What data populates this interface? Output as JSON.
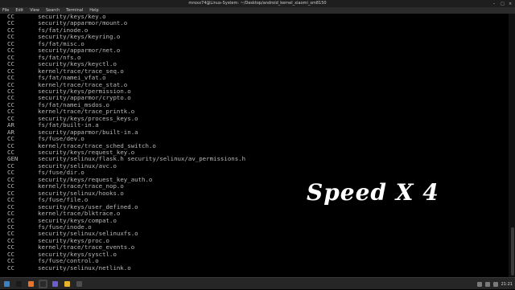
{
  "window": {
    "title": "mroxx74@Linux-System: ~/Desktop/android_kernel_xiaomi_sm8150"
  },
  "menubar": {
    "items": [
      "File",
      "Edit",
      "View",
      "Search",
      "Terminal",
      "Help"
    ]
  },
  "terminal": {
    "lines": [
      {
        "cmd": "CC",
        "path": "security/keys/key.o"
      },
      {
        "cmd": "CC",
        "path": "security/apparmor/mount.o"
      },
      {
        "cmd": "CC",
        "path": "fs/fat/inode.o"
      },
      {
        "cmd": "CC",
        "path": "security/keys/keyring.o"
      },
      {
        "cmd": "CC",
        "path": "fs/fat/misc.o"
      },
      {
        "cmd": "CC",
        "path": "security/apparmor/net.o"
      },
      {
        "cmd": "CC",
        "path": "fs/fat/nfs.o"
      },
      {
        "cmd": "CC",
        "path": "security/keys/keyctl.o"
      },
      {
        "cmd": "CC",
        "path": "kernel/trace/trace_seq.o"
      },
      {
        "cmd": "CC",
        "path": "fs/fat/namei_vfat.o"
      },
      {
        "cmd": "CC",
        "path": "kernel/trace/trace_stat.o"
      },
      {
        "cmd": "CC",
        "path": "security/keys/permission.o"
      },
      {
        "cmd": "CC",
        "path": "security/apparmor/crypto.o"
      },
      {
        "cmd": "CC",
        "path": "fs/fat/namei_msdos.o"
      },
      {
        "cmd": "CC",
        "path": "kernel/trace/trace_printk.o"
      },
      {
        "cmd": "CC",
        "path": "security/keys/process_keys.o"
      },
      {
        "cmd": "AR",
        "path": "fs/fat/built-in.a"
      },
      {
        "cmd": "AR",
        "path": "security/apparmor/built-in.a"
      },
      {
        "cmd": "CC",
        "path": "fs/fuse/dev.o"
      },
      {
        "cmd": "CC",
        "path": "kernel/trace/trace_sched_switch.o"
      },
      {
        "cmd": "CC",
        "path": "security/keys/request_key.o"
      },
      {
        "cmd": "GEN",
        "path": "security/selinux/flask.h security/selinux/av_permissions.h"
      },
      {
        "cmd": "CC",
        "path": "security/selinux/avc.o"
      },
      {
        "cmd": "CC",
        "path": "fs/fuse/dir.o"
      },
      {
        "cmd": "CC",
        "path": "security/keys/request_key_auth.o"
      },
      {
        "cmd": "CC",
        "path": "kernel/trace/trace_nop.o"
      },
      {
        "cmd": "CC",
        "path": "security/selinux/hooks.o"
      },
      {
        "cmd": "CC",
        "path": "fs/fuse/file.o"
      },
      {
        "cmd": "CC",
        "path": "security/keys/user_defined.o"
      },
      {
        "cmd": "CC",
        "path": "kernel/trace/blktrace.o"
      },
      {
        "cmd": "CC",
        "path": "security/keys/compat.o"
      },
      {
        "cmd": "CC",
        "path": "fs/fuse/inode.o"
      },
      {
        "cmd": "CC",
        "path": "security/selinux/selinuxfs.o"
      },
      {
        "cmd": "CC",
        "path": "security/keys/proc.o"
      },
      {
        "cmd": "CC",
        "path": "kernel/trace/trace_events.o"
      },
      {
        "cmd": "CC",
        "path": "security/keys/sysctl.o"
      },
      {
        "cmd": "CC",
        "path": "fs/fuse/control.o"
      },
      {
        "cmd": "CC",
        "path": "security/selinux/netlink.o"
      }
    ]
  },
  "overlay": {
    "text": "Speed X 4"
  },
  "taskbar": {
    "apps": [
      {
        "name": "menu-icon",
        "color": "#3b82c4"
      },
      {
        "name": "terminal-icon",
        "color": "#1a1a1a"
      },
      {
        "name": "firefox-icon",
        "color": "#e8742c"
      },
      {
        "name": "terminal-active-icon",
        "color": "#2a2a2a"
      },
      {
        "name": "files-icon",
        "color": "#6b5fd0"
      },
      {
        "name": "chrome-icon",
        "color": "#e6b62a"
      },
      {
        "name": "text-editor-icon",
        "color": "#4d4d4d"
      }
    ],
    "clock": "21:21"
  },
  "colors": {
    "terminal_bg": "#000000",
    "terminal_fg": "#b9b9b9",
    "overlay_fg": "#ffffff"
  }
}
